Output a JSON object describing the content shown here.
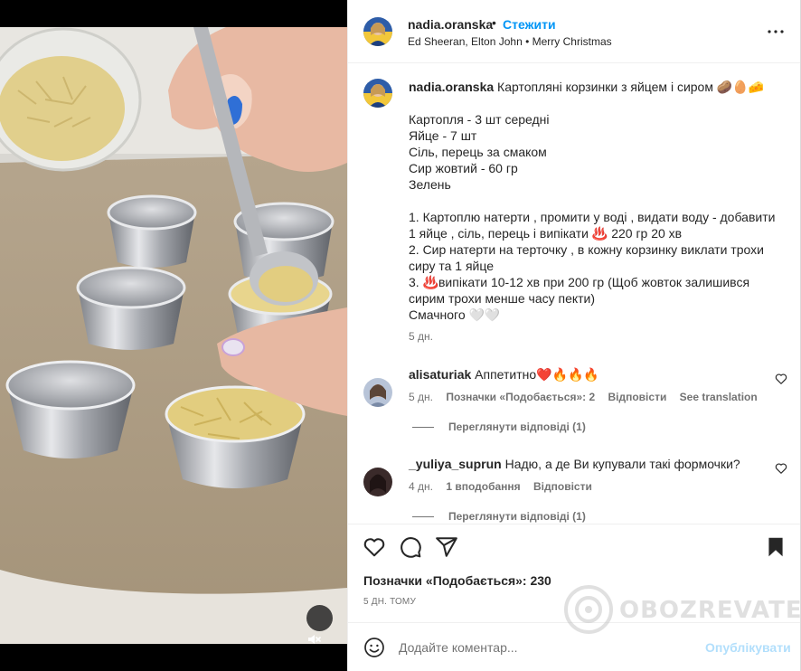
{
  "post": {
    "username": "nadia.oranska",
    "dot": "•",
    "follow_label": "Стежити",
    "music": "Ed Sheeran, Elton John • Merry Christmas",
    "more_icon": "more-horizontal-icon",
    "caption": {
      "username": "nadia.oranska",
      "text": " Картопляні корзинки з яйцем і сиром 🥔🥚🧀\n\nКартопля - 3 шт середні\nЯйце - 7 шт\nСіль, перець за смаком\nСир жовтий - 60 гр\nЗелень\n\n1. Картоплю натерти , промити у воді , видати воду - добавити\n1 яйце , сіль, перець і випікати ♨️ 220 гр 20 хв\n2. Сир натерти на терточку , в кожну корзинку виклати трохи\nсиру та 1 яйце\n3. ♨️випікати 10-12 хв при 200 гр (Щоб жовток залишився\nсирим трохи менше часу пекти)\nСмачного 🤍🤍",
      "time": "5 дн."
    }
  },
  "comments": [
    {
      "username": "alisaturiak",
      "text": " Аппетитно❤️🔥🔥🔥",
      "time": "5 дн.",
      "likes": "Позначки «Подобається»: 2",
      "reply": "Відповісти",
      "translate": "See translation",
      "view_replies": "Переглянути відповіді (1)"
    },
    {
      "username": "_yuliya_suprun",
      "text": " Надю, а де Ви купували такі формочки?",
      "time": "4 дн.",
      "likes": "1 вподобання",
      "reply": "Відповісти",
      "view_replies": "Переглянути відповіді (1)"
    }
  ],
  "actions": {
    "like_icon": "heart-icon",
    "comment_icon": "comment-icon",
    "share_icon": "share-icon",
    "save_icon": "bookmark-icon",
    "likes_text": "Позначки «Подобається»: 230",
    "date": "5 ДН. ТОМУ"
  },
  "comment_box": {
    "emoji_icon": "emoji-icon",
    "placeholder": "Додайте коментар...",
    "publish_label": "Опублікувати"
  },
  "media": {
    "mute_icon": "speaker-muted-icon"
  },
  "watermark": {
    "text": "OBOZREVATEL"
  },
  "colors": {
    "accent": "#0095f6",
    "publish_disabled": "#b2dffc",
    "secondary_text": "#737373"
  }
}
